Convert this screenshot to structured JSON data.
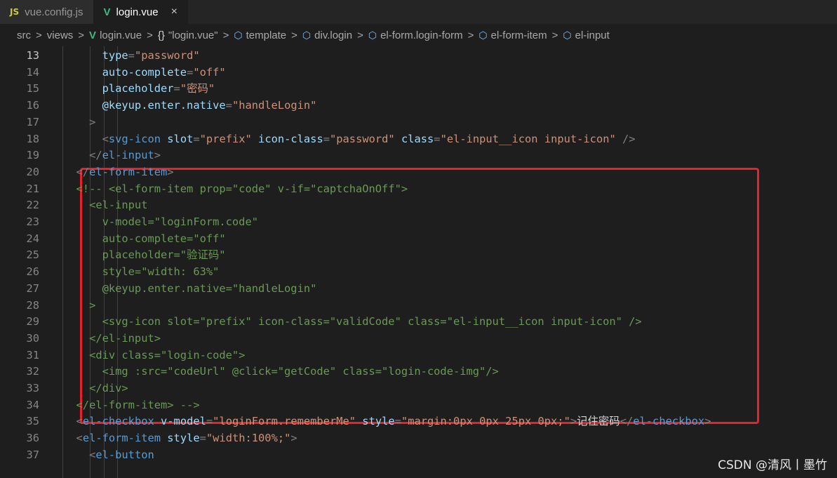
{
  "tabs": [
    {
      "icon": "js-icon",
      "icon_text": "JS",
      "label": "vue.config.js",
      "active": false
    },
    {
      "icon": "vue-icon",
      "icon_text": "V",
      "label": "login.vue",
      "active": true,
      "close": "×"
    }
  ],
  "breadcrumb": {
    "items": [
      {
        "icon": "",
        "label": "src"
      },
      {
        "icon": "",
        "label": "views"
      },
      {
        "icon": "vue-icon",
        "label": "login.vue"
      },
      {
        "icon": "braces-icon",
        "icon_text": "{}",
        "label": "\"login.vue\""
      },
      {
        "icon": "cube-icon",
        "label": "template"
      },
      {
        "icon": "cube-icon",
        "label": "div.login"
      },
      {
        "icon": "cube-icon",
        "label": "el-form.login-form"
      },
      {
        "icon": "cube-icon",
        "label": "el-form-item"
      },
      {
        "icon": "cube-icon",
        "label": "el-input"
      }
    ],
    "separator": ">"
  },
  "code": {
    "active_line": 13,
    "lines": [
      {
        "n": "13",
        "segs": [
          [
            "attr",
            "      type"
          ],
          [
            "punc",
            "="
          ],
          [
            "str",
            "\"password\""
          ]
        ]
      },
      {
        "n": "14",
        "segs": [
          [
            "attr",
            "      auto-complete"
          ],
          [
            "punc",
            "="
          ],
          [
            "str",
            "\"off\""
          ]
        ]
      },
      {
        "n": "15",
        "segs": [
          [
            "attr",
            "      placeholder"
          ],
          [
            "punc",
            "="
          ],
          [
            "str",
            "\"密码\""
          ]
        ]
      },
      {
        "n": "16",
        "segs": [
          [
            "attr",
            "      @keyup.enter.native"
          ],
          [
            "punc",
            "="
          ],
          [
            "str",
            "\"handleLogin\""
          ]
        ]
      },
      {
        "n": "17",
        "segs": [
          [
            "punc",
            "    >"
          ]
        ]
      },
      {
        "n": "18",
        "segs": [
          [
            "punc",
            "      <"
          ],
          [
            "tag",
            "svg-icon"
          ],
          [
            "attr",
            " slot"
          ],
          [
            "punc",
            "="
          ],
          [
            "str",
            "\"prefix\""
          ],
          [
            "attr",
            " icon-class"
          ],
          [
            "punc",
            "="
          ],
          [
            "str",
            "\"password\""
          ],
          [
            "attr",
            " class"
          ],
          [
            "punc",
            "="
          ],
          [
            "str",
            "\"el-input__icon input-icon\""
          ],
          [
            "punc",
            " />"
          ]
        ]
      },
      {
        "n": "19",
        "segs": [
          [
            "punc",
            "    </"
          ],
          [
            "tag",
            "el-input"
          ],
          [
            "punc",
            ">"
          ]
        ]
      },
      {
        "n": "20",
        "segs": [
          [
            "punc",
            "  </"
          ],
          [
            "tag",
            "el-form-item"
          ],
          [
            "punc",
            ">"
          ]
        ]
      },
      {
        "n": "21",
        "segs": [
          [
            "com",
            "  <!-- <el-form-item prop=\"code\" v-if=\"captchaOnOff\">"
          ]
        ]
      },
      {
        "n": "22",
        "segs": [
          [
            "com",
            "    <el-input"
          ]
        ]
      },
      {
        "n": "23",
        "segs": [
          [
            "com",
            "      v-model=\"loginForm.code\""
          ]
        ]
      },
      {
        "n": "24",
        "segs": [
          [
            "com",
            "      auto-complete=\"off\""
          ]
        ]
      },
      {
        "n": "25",
        "segs": [
          [
            "com",
            "      placeholder=\"验证码\""
          ]
        ]
      },
      {
        "n": "26",
        "segs": [
          [
            "com",
            "      style=\"width: 63%\""
          ]
        ]
      },
      {
        "n": "27",
        "segs": [
          [
            "com",
            "      @keyup.enter.native=\"handleLogin\""
          ]
        ]
      },
      {
        "n": "28",
        "segs": [
          [
            "com",
            "    >"
          ]
        ]
      },
      {
        "n": "29",
        "segs": [
          [
            "com",
            "      <svg-icon slot=\"prefix\" icon-class=\"validCode\" class=\"el-input__icon input-icon\" />"
          ]
        ]
      },
      {
        "n": "30",
        "segs": [
          [
            "com",
            "    </el-input>"
          ]
        ]
      },
      {
        "n": "31",
        "segs": [
          [
            "com",
            "    <div class=\"login-code\">"
          ]
        ]
      },
      {
        "n": "32",
        "segs": [
          [
            "com",
            "      <img :src=\"codeUrl\" @click=\"getCode\" class=\"login-code-img\"/>"
          ]
        ]
      },
      {
        "n": "33",
        "segs": [
          [
            "com",
            "    </div>"
          ]
        ]
      },
      {
        "n": "34",
        "segs": [
          [
            "com",
            "  </el-form-item> -->"
          ]
        ]
      },
      {
        "n": "35",
        "segs": [
          [
            "punc",
            "  <"
          ],
          [
            "tag",
            "el-checkbox"
          ],
          [
            "attr",
            " v-model"
          ],
          [
            "punc",
            "="
          ],
          [
            "str",
            "\"loginForm.rememberMe\""
          ],
          [
            "attr",
            " style"
          ],
          [
            "punc",
            "="
          ],
          [
            "str",
            "\"margin:0px 0px 25px 0px;\""
          ],
          [
            "punc",
            ">"
          ],
          [
            "text",
            "记住密码"
          ],
          [
            "punc",
            "</"
          ],
          [
            "tag",
            "el-checkbox"
          ],
          [
            "punc",
            ">"
          ]
        ]
      },
      {
        "n": "36",
        "segs": [
          [
            "punc",
            "  <"
          ],
          [
            "tag",
            "el-form-item"
          ],
          [
            "attr",
            " style"
          ],
          [
            "punc",
            "="
          ],
          [
            "str",
            "\"width:100%;\""
          ],
          [
            "punc",
            ">"
          ]
        ]
      },
      {
        "n": "37",
        "segs": [
          [
            "punc",
            "    <"
          ],
          [
            "tag",
            "el-button"
          ]
        ]
      }
    ]
  },
  "watermark": "CSDN @清风丨墨竹"
}
